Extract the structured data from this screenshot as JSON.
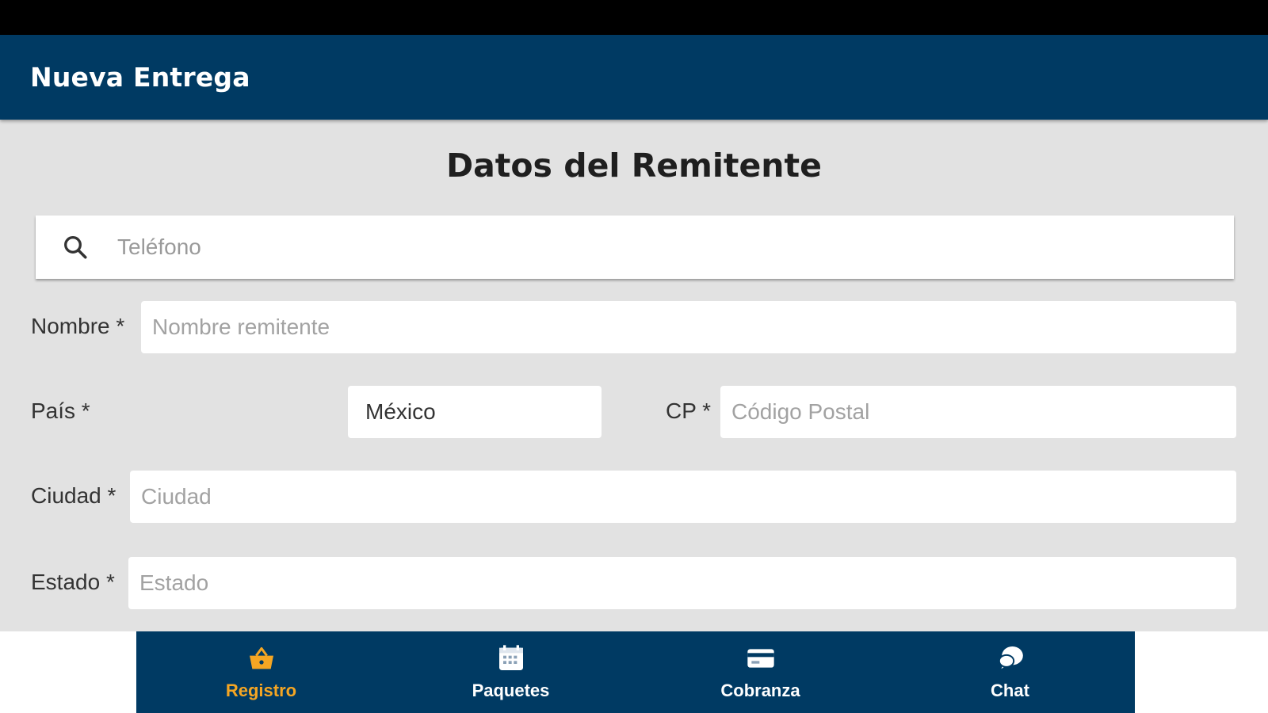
{
  "app_bar": {
    "title": "Nueva Entrega"
  },
  "form": {
    "section_title": "Datos del Remitente",
    "search": {
      "placeholder": "Teléfono",
      "icon": "search-icon"
    },
    "nombre": {
      "label": "Nombre *",
      "placeholder": "Nombre remitente",
      "value": ""
    },
    "pais": {
      "label": "País *",
      "value": "México"
    },
    "cp": {
      "label": "CP *",
      "placeholder": "Código Postal",
      "value": ""
    },
    "ciudad": {
      "label": "Ciudad *",
      "placeholder": "Ciudad",
      "value": ""
    },
    "estado": {
      "label": "Estado *",
      "placeholder": "Estado",
      "value": ""
    }
  },
  "bottom_nav": {
    "items": [
      {
        "label": "Registro",
        "icon": "basket-icon",
        "active": true
      },
      {
        "label": "Paquetes",
        "icon": "calendar-icon",
        "active": false
      },
      {
        "label": "Cobranza",
        "icon": "card-icon",
        "active": false
      },
      {
        "label": "Chat",
        "icon": "chat-icon",
        "active": false
      }
    ]
  },
  "colors": {
    "primary": "#003a63",
    "accent": "#f5a623",
    "background": "#e2e2e2",
    "status_bar": "#000000"
  }
}
